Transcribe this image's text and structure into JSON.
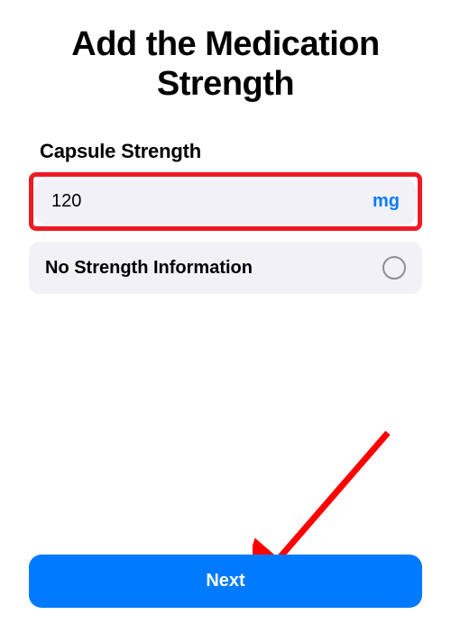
{
  "page_title": "Add the Medica­tion Strength",
  "section_label": "Capsule Strength",
  "strength_input": {
    "value": "120",
    "unit": "mg"
  },
  "no_strength_option": {
    "label": "No Strength Information",
    "selected": false
  },
  "next_button_label": "Next",
  "annotation": {
    "highlight_color": "#ee1b24",
    "arrow_color": "#ff0000"
  }
}
